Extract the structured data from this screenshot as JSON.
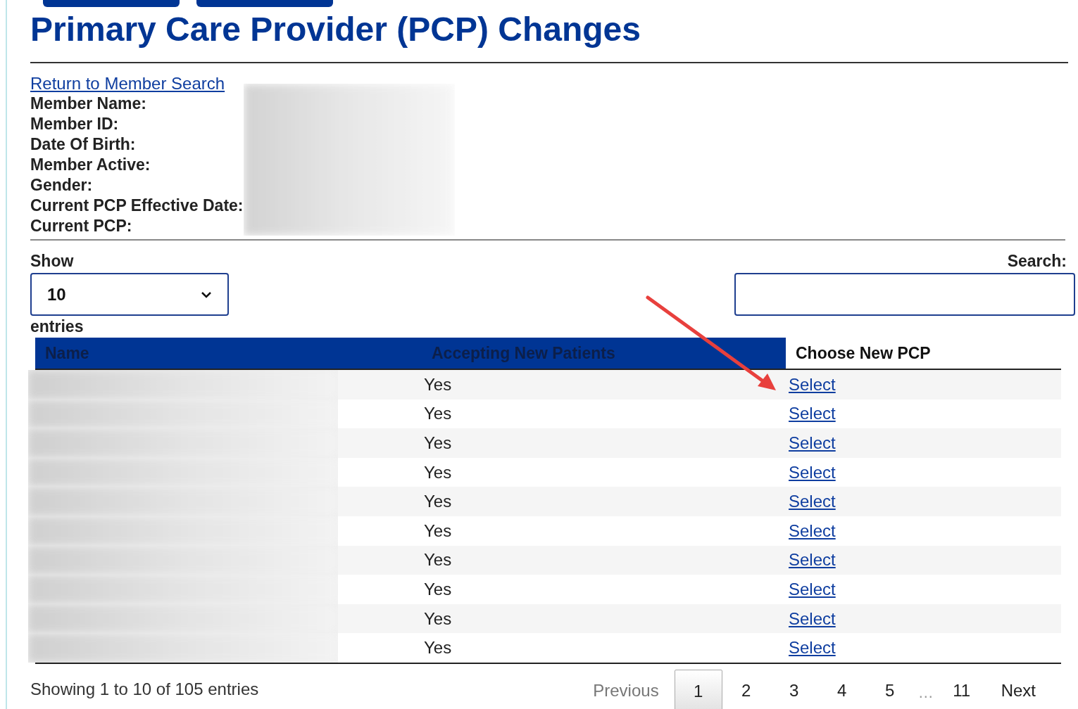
{
  "title": "Primary Care Provider (PCP) Changes",
  "return_link": "Return to Member Search",
  "member_fields": [
    {
      "label": "Member Name:"
    },
    {
      "label": "Member ID:"
    },
    {
      "label": "Date Of Birth:"
    },
    {
      "label": "Member Active:"
    },
    {
      "label": "Gender:"
    },
    {
      "label": "Current PCP Effective Date:"
    },
    {
      "label": "Current PCP:"
    }
  ],
  "length_menu": {
    "before": "Show",
    "value": "10",
    "after": "entries"
  },
  "search": {
    "label": "Search:"
  },
  "table": {
    "columns": [
      {
        "label": "Name",
        "highlighted": true
      },
      {
        "label": "Accepting New Patients",
        "highlighted": true
      },
      {
        "label": "Choose New PCP",
        "highlighted": false
      }
    ],
    "rows": [
      {
        "accepting": "Yes",
        "action": "Select"
      },
      {
        "accepting": "Yes",
        "action": "Select"
      },
      {
        "accepting": "Yes",
        "action": "Select"
      },
      {
        "accepting": "Yes",
        "action": "Select"
      },
      {
        "accepting": "Yes",
        "action": "Select"
      },
      {
        "accepting": "Yes",
        "action": "Select"
      },
      {
        "accepting": "Yes",
        "action": "Select"
      },
      {
        "accepting": "Yes",
        "action": "Select"
      },
      {
        "accepting": "Yes",
        "action": "Select"
      },
      {
        "accepting": "Yes",
        "action": "Select"
      }
    ]
  },
  "info": "Showing 1 to 10 of 105 entries",
  "pagination": [
    {
      "kind": "nav",
      "label": "Previous",
      "disabled": true
    },
    {
      "kind": "page",
      "label": "1",
      "selected": true
    },
    {
      "kind": "page",
      "label": "2",
      "selected": false
    },
    {
      "kind": "page",
      "label": "3",
      "selected": false
    },
    {
      "kind": "page",
      "label": "4",
      "selected": false
    },
    {
      "kind": "page",
      "label": "5",
      "selected": false
    },
    {
      "kind": "ellipsis",
      "label": "…"
    },
    {
      "kind": "page",
      "label": "11",
      "selected": false
    },
    {
      "kind": "nav",
      "label": "Next",
      "disabled": false
    }
  ]
}
